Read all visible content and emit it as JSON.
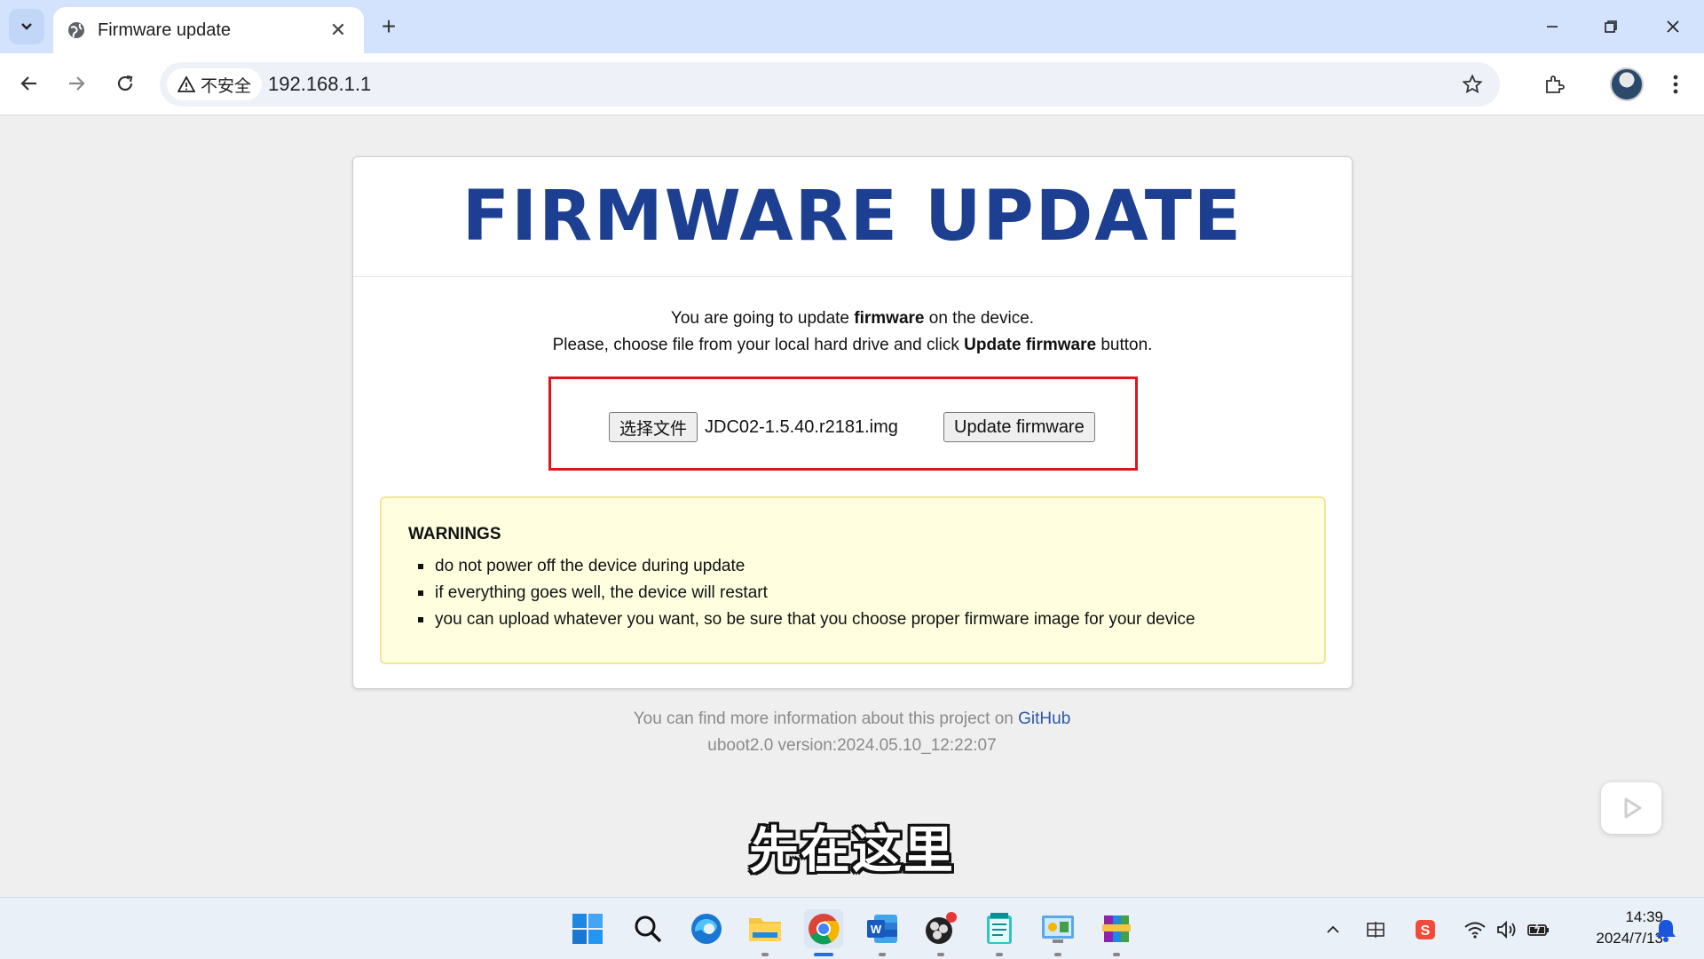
{
  "browser": {
    "tab_title": "Firmware update",
    "security_label": "不安全",
    "url": "192.168.1.1"
  },
  "page": {
    "title": "FIRMWARE UPDATE",
    "intro_line1_pre": "You are going to update ",
    "intro_line1_bold": "firmware",
    "intro_line1_post": " on the device.",
    "intro_line2_pre": "Please, choose file from your local hard drive and click ",
    "intro_line2_bold": "Update firmware",
    "intro_line2_post": " button.",
    "choose_file_label": "选择文件",
    "selected_file": "JDC02-1.5.40.r2181.img",
    "update_button_label": "Update firmware",
    "warnings_title": "WARNINGS",
    "warnings": [
      "do not power off the device during update",
      "if everything goes well, the device will restart",
      "you can upload whatever you want, so be sure that you choose proper firmware image for your device"
    ],
    "footer_pre": "You can find more information about this project on ",
    "footer_link": "GitHub",
    "footer_version": "uboot2.0 version:2024.05.10_12:22:07"
  },
  "overlay": {
    "subtitle": "先在这里"
  },
  "taskbar": {
    "apps": [
      "start-icon",
      "search-icon",
      "edge-icon",
      "file-explorer-icon",
      "chrome-icon",
      "word-icon",
      "obs-icon",
      "notepad-icon",
      "control-panel-icon",
      "winrar-icon"
    ],
    "time": "14:39",
    "date": "2024/7/13"
  },
  "colors": {
    "title_blue": "#1d3f91",
    "highlight_red": "#e0141e",
    "warning_bg": "#ffffe0",
    "link_blue": "#2a58a6"
  }
}
